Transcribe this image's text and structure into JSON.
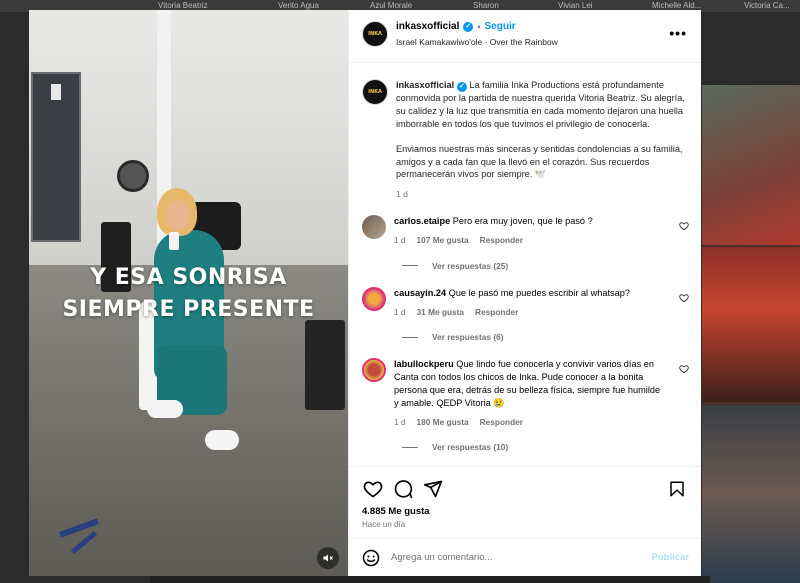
{
  "background": {
    "story_names": [
      "Vitoria Beatriz",
      "Verito Agua",
      "Azul Morale",
      "Sharon",
      "Vivian Lei",
      "Michelle Ald...",
      "Victoria Ca..."
    ]
  },
  "post": {
    "media": {
      "overlay_line1": "Y ESA SONRISA",
      "overlay_line2": "SIEMPRE PRESENTE",
      "mute_icon": "speaker-muted-icon"
    },
    "header": {
      "avatar_text": "INKA",
      "username": "inkasxofficial",
      "verified_mark": "✓",
      "separator": "•",
      "follow_label": "Seguir",
      "audio_artist": "Israel Kamakawiwo'ole",
      "audio_separator": "·",
      "audio_title": "Over the Rainbow",
      "more_label": "•••"
    },
    "caption": {
      "username": "inkasxofficial",
      "paragraph1": "La familia Inka Productions está profundamente conmovida por la partida de nuestra querida Vitoria Beatriz. Su alegría, su calidez y la luz que transmitía en cada momento dejaron una huella imborrable en todos los que tuvimos el privilegio de conocerla.",
      "paragraph2": "Enviamos nuestras más sinceras y sentidas condolencias a su familia, amigos y a cada fan que la llevó en el corazón. Sus recuerdos permanecerán vivos por siempre. 🕊️",
      "time": "1 d"
    },
    "comments": [
      {
        "username": "carlos.etaipe",
        "text": "Pero era muy joven, que le pasó ?",
        "time": "1 d",
        "likes": "107 Me gusta",
        "reply_label": "Responder",
        "view_replies": "Ver respuestas (25)"
      },
      {
        "username": "causayin.24",
        "text": "Que le pasó me puedes escribir al whatsap?",
        "time": "1 d",
        "likes": "31 Me gusta",
        "reply_label": "Responder",
        "view_replies": "Ver respuestas (6)"
      },
      {
        "username": "labullockperu",
        "text": "Que lindo fue conocerla y convivir varios días en Canta con todos los chicos de Inka. Pude conocer a la bonita persona que era, detrás de su belleza física, siempre fue humilde y amable. QEDP Vitoria 😢",
        "time": "1 d",
        "likes": "180 Me gusta",
        "reply_label": "Responder",
        "view_replies": "Ver respuestas (10)"
      }
    ],
    "actions": {
      "likes": "4.885 Me gusta",
      "ago": "Hace un día"
    },
    "comment_box": {
      "placeholder": "Agrega un comentario...",
      "publish_label": "Publicar"
    }
  }
}
